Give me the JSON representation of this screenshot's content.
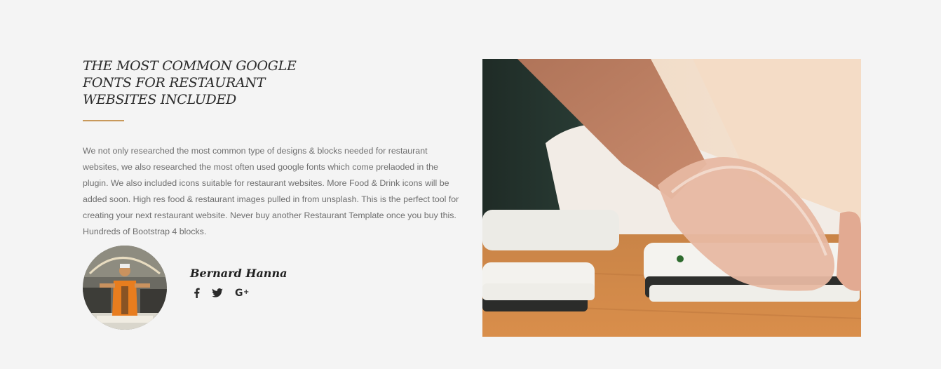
{
  "section": {
    "title": "THE MOST COMMON GOOGLE FONTS FOR RESTAURANT WEBSITES INCLUDED",
    "description": "We not only researched the most common type of designs & blocks needed for restaurant websites, we also researched the most often used google fonts which come prelaoded in the plugin. We also included icons suitable for restaurant websites. More Food & Drink icons will be added soon. High res food & restaurant images pulled in from unsplash. This is the perfect tool for creating your next restaurant website. Never buy another Restaurant Template once you buy this. Hundreds of Bootstrap 4 blocks."
  },
  "author": {
    "name": "Bernard Hanna",
    "socials": [
      {
        "icon": "facebook-icon"
      },
      {
        "icon": "twitter-icon"
      },
      {
        "icon": "google-plus-icon"
      }
    ]
  },
  "colors": {
    "background": "#f4f4f4",
    "accent": "#c8995b",
    "title": "#2b2b2b",
    "text": "#6f6f6f"
  }
}
